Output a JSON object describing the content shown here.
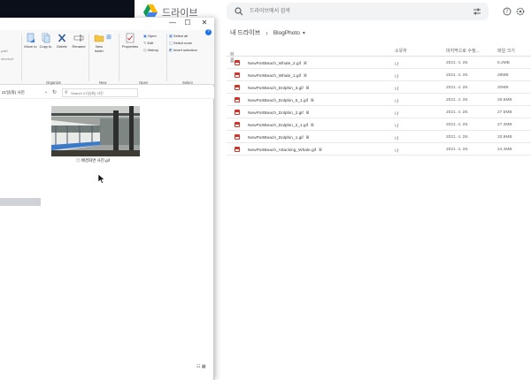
{
  "drive": {
    "app_name": "드라이브",
    "search_placeholder": "드라이브에서 검색",
    "breadcrumb": {
      "root": "내 드라이브",
      "current": "BlogPhoto"
    },
    "columns": {
      "name": "이름",
      "owner": "소유자",
      "modified": "마지막으로 수정...",
      "size": "파일 크기"
    },
    "files": [
      {
        "name": "NewPortBeach_Whale_2.gif",
        "owner": "나",
        "modified": "2021. 4. 28.",
        "size": "5.2MB"
      },
      {
        "name": "NewPortBeach_Whale_1.gif",
        "owner": "나",
        "modified": "2021. 4. 28.",
        "size": "28MB"
      },
      {
        "name": "NewPortBeach_Dolphin_3.gif",
        "owner": "나",
        "modified": "2021. 4. 28.",
        "size": "20MB"
      },
      {
        "name": "NewPortBeach_Dolphin_5_1.gif",
        "owner": "나",
        "modified": "2021. 4. 28.",
        "size": "25.5MB"
      },
      {
        "name": "NewPortBeach_Dolphin_2.gif",
        "owner": "나",
        "modified": "2021. 4. 28.",
        "size": "27.5MB"
      },
      {
        "name": "NewPortBeach_Dolphin_2_1.gif",
        "owner": "나",
        "modified": "2021. 4. 28.",
        "size": "27.3MB"
      },
      {
        "name": "NewPortBeach_Dolphin_1.gif",
        "owner": "나",
        "modified": "2021. 4. 28.",
        "size": "33.9MB"
      },
      {
        "name": "NewPortBeach_Attacking_Whale.gif",
        "owner": "나",
        "modified": "2021. 4. 28.",
        "size": "24.4MB"
      }
    ],
    "colors": {
      "file_icon": "#d93025",
      "accent": "#1a73e8"
    }
  },
  "explorer": {
    "window_controls": {
      "minimize": "—",
      "maximize": "☐",
      "close": "✕"
    },
    "ribbon": {
      "left_partial": [
        "path",
        "shortcut"
      ],
      "move_to": "Move to",
      "copy_to": "Copy to",
      "delete": "Delete",
      "rename": "Rename",
      "new_folder": "New folder",
      "properties": "Properties",
      "open": "Open",
      "edit": "Edit",
      "history": "History",
      "select_all": "Select all",
      "select_none": "Select none",
      "invert_selection": "Invert selection",
      "group_organize": "Organize",
      "group_new": "New",
      "group_open": "Open",
      "group_select": "Select"
    },
    "address": "21일(화) 사진",
    "search_placeholder": "Search 21일(화) 사진",
    "thumbnail_caption": "배경화면 사진.gif"
  }
}
